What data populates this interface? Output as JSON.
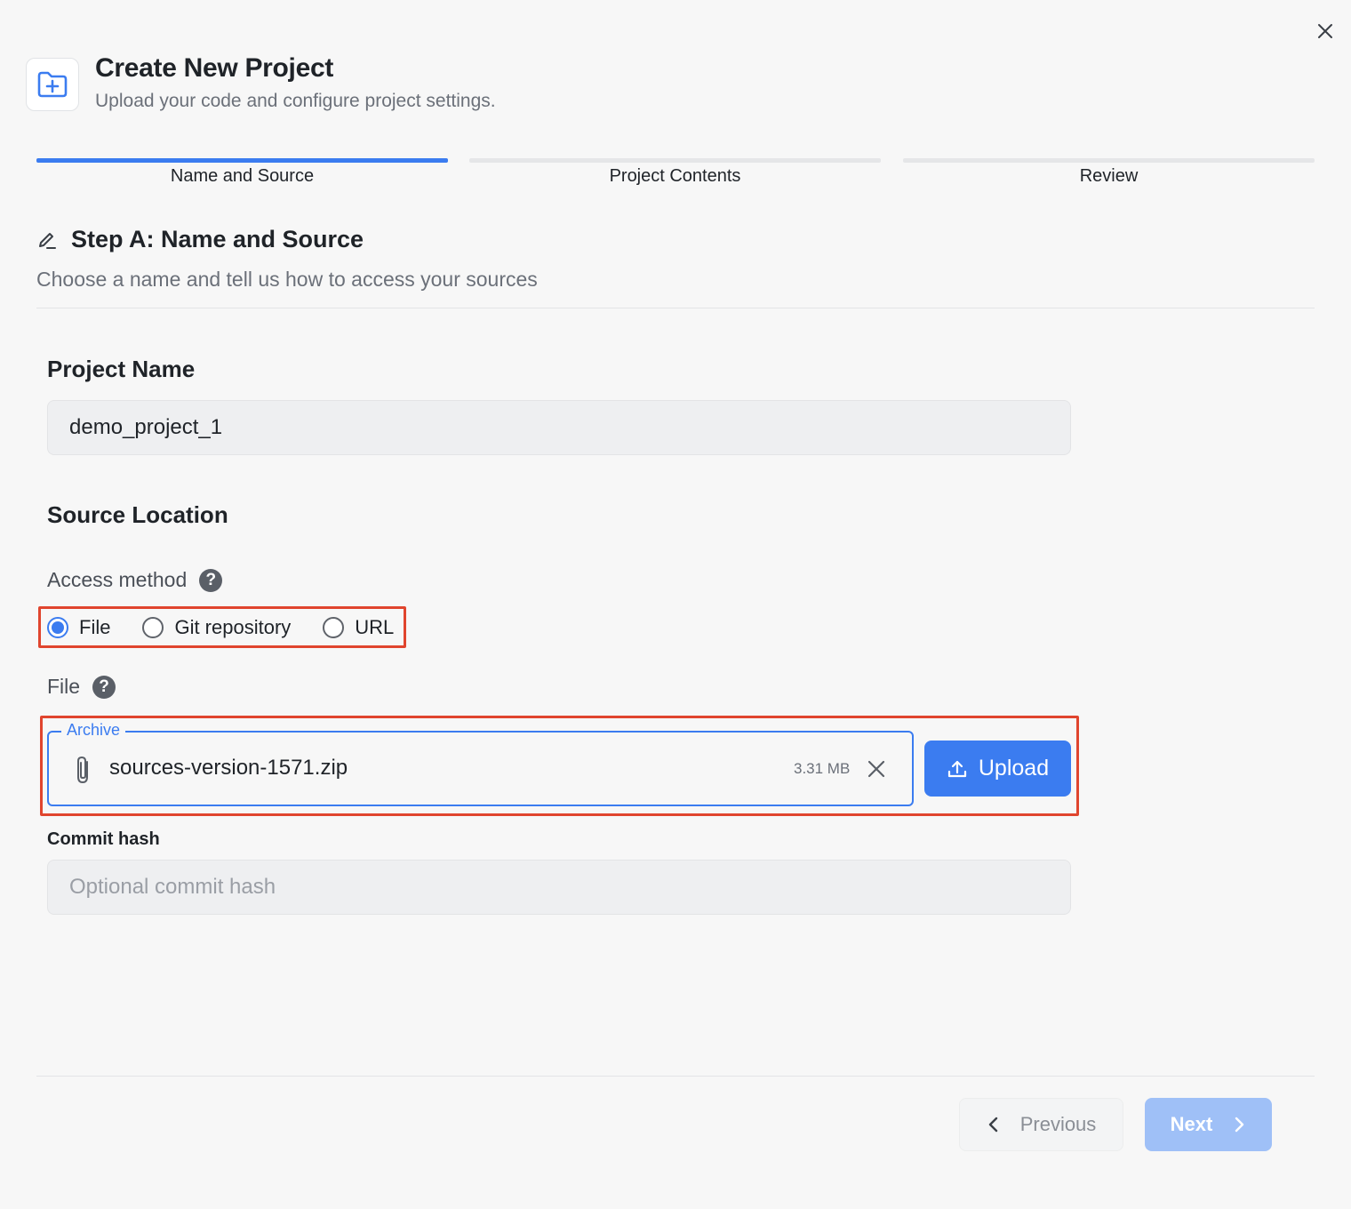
{
  "dialog": {
    "title": "Create New Project",
    "subtitle": "Upload your code and configure project settings.",
    "header_icon": "folder-plus-icon",
    "close_icon": "close-icon"
  },
  "steps": [
    {
      "label": "Name and Source",
      "active": true
    },
    {
      "label": "Project Contents",
      "active": false
    },
    {
      "label": "Review",
      "active": false
    }
  ],
  "section": {
    "icon": "pen-icon",
    "title": "Step A: Name and Source",
    "description": "Choose a name and tell us how to access your sources"
  },
  "project_name": {
    "label": "Project Name",
    "value": "demo_project_1"
  },
  "source_location": {
    "title": "Source Location",
    "access_method_label": "Access method",
    "help_glyph": "?",
    "options": [
      {
        "label": "File",
        "checked": true
      },
      {
        "label": "Git repository",
        "checked": false
      },
      {
        "label": "URL",
        "checked": false
      }
    ],
    "file_label": "File",
    "archive": {
      "legend": "Archive",
      "file_name": "sources-version-1571.zip",
      "file_size": "3.31 MB",
      "attach_icon": "paperclip-icon",
      "remove_icon": "close-icon"
    },
    "upload_button": {
      "label": "Upload",
      "icon": "upload-icon"
    }
  },
  "commit_hash": {
    "label": "Commit hash",
    "value": "",
    "placeholder": "Optional commit hash"
  },
  "footer": {
    "previous_label": "Previous",
    "next_label": "Next"
  },
  "colors": {
    "accent": "#3b7cf0",
    "highlight": "#e0452e",
    "background": "#f7f7f7",
    "next_disabled": "#9fc0f7"
  }
}
